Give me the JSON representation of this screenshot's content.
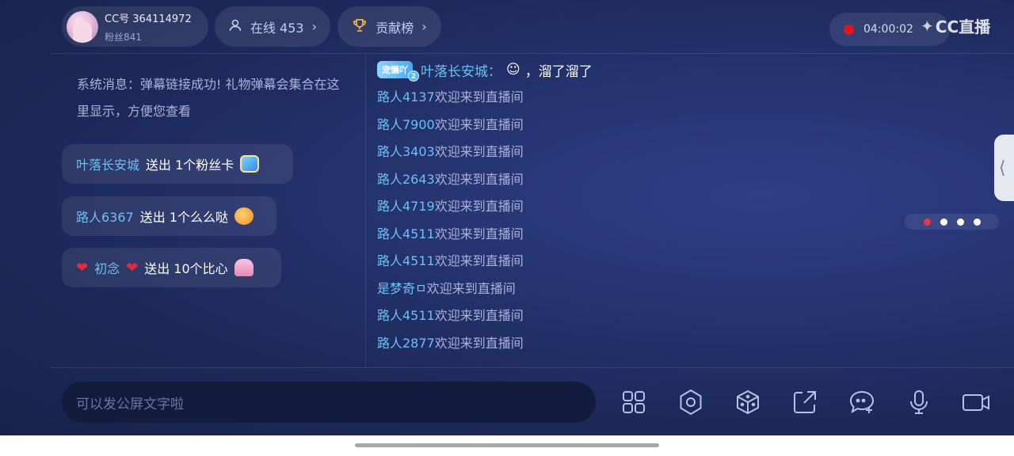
{
  "profile": {
    "cc_id": "CC号 364114972",
    "fans": "粉丝841"
  },
  "online": {
    "label": "在线 453",
    "chevron": "›"
  },
  "contribution": {
    "label": "贡献榜",
    "chevron": "›"
  },
  "timer": {
    "value": "04:00:02"
  },
  "logo": {
    "text": "CC直播"
  },
  "system_message": "系统消息：弹幕链接成功! 礼物弹幕会集合在这里显示，方便您查看",
  "gifts": [
    {
      "name": "叶落长安城",
      "action": "送出 1个粉丝卡"
    },
    {
      "name": "路人6367",
      "action": "送出 1个么么哒"
    },
    {
      "name": "初念",
      "action": "送出 10个比心"
    }
  ],
  "chat_first": {
    "badge": "宠懒吖",
    "level": "2",
    "name": "叶落长安城：",
    "text": "，溜了溜了"
  },
  "chat": [
    {
      "name": "路人4137",
      "text": "欢迎来到直播间"
    },
    {
      "name": "路人7900",
      "text": "欢迎来到直播间"
    },
    {
      "name": "路人3403",
      "text": "欢迎来到直播间"
    },
    {
      "name": "路人2643",
      "text": "欢迎来到直播间"
    },
    {
      "name": "路人4719",
      "text": "欢迎来到直播间"
    },
    {
      "name": "路人4511",
      "text": "欢迎来到直播间"
    },
    {
      "name": "路人4511",
      "text": "欢迎来到直播间"
    },
    {
      "name": "是梦奇ㅁ",
      "text": "欢迎来到直播间"
    },
    {
      "name": "路人4511",
      "text": "欢迎来到直播间"
    },
    {
      "name": "路人2877",
      "text": "欢迎来到直播间"
    }
  ],
  "input": {
    "placeholder": "可以发公屏文字啦"
  },
  "page_indicator": {
    "count": 4,
    "active": 0
  },
  "colors": {
    "accent_name": "#6cc0f4",
    "record": "#e0151d",
    "background": "#1f2b5e"
  },
  "toolbar": [
    "grid-icon",
    "settings-icon",
    "dice-icon",
    "share-icon",
    "add-chat-icon",
    "microphone-icon",
    "camera-icon"
  ]
}
